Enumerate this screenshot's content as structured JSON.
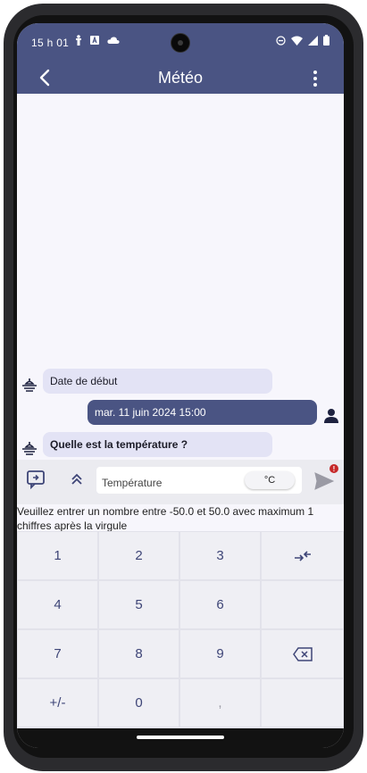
{
  "status_bar": {
    "time": "15 h 01"
  },
  "app_bar": {
    "title": "Météo"
  },
  "messages": [
    {
      "sender": "bot",
      "text": "Date de début"
    },
    {
      "sender": "user",
      "text": "mar. 11 juin 2024 15:00"
    },
    {
      "sender": "bot",
      "text": "Quelle est la température ?"
    }
  ],
  "input": {
    "placeholder": "Température",
    "unit": "°C",
    "badge": "!"
  },
  "hint_text": "Veuillez entrer un nombre entre -50.0 et 50.0 avec maximum 1 chiffres après la virgule",
  "keypad": {
    "keys": [
      "1",
      "2",
      "3",
      "4",
      "5",
      "6",
      "7",
      "8",
      "9",
      "+/-",
      "0",
      ","
    ]
  },
  "icons": {
    "status_left": [
      "accessibility-icon",
      "a-box-icon",
      "cloud-icon"
    ],
    "status_right": [
      "dnd-icon",
      "wifi-icon",
      "signal-icon",
      "battery-icon"
    ],
    "bot": "bot-avatar-icon",
    "user": "person-icon",
    "keypad_enter": "enter-arrow-icon",
    "keypad_backspace": "backspace-icon"
  },
  "colors": {
    "primary": "#4a5483",
    "bot_bubble": "#e3e3f5",
    "background": "#f7f6fc",
    "badge": "#c62828"
  }
}
